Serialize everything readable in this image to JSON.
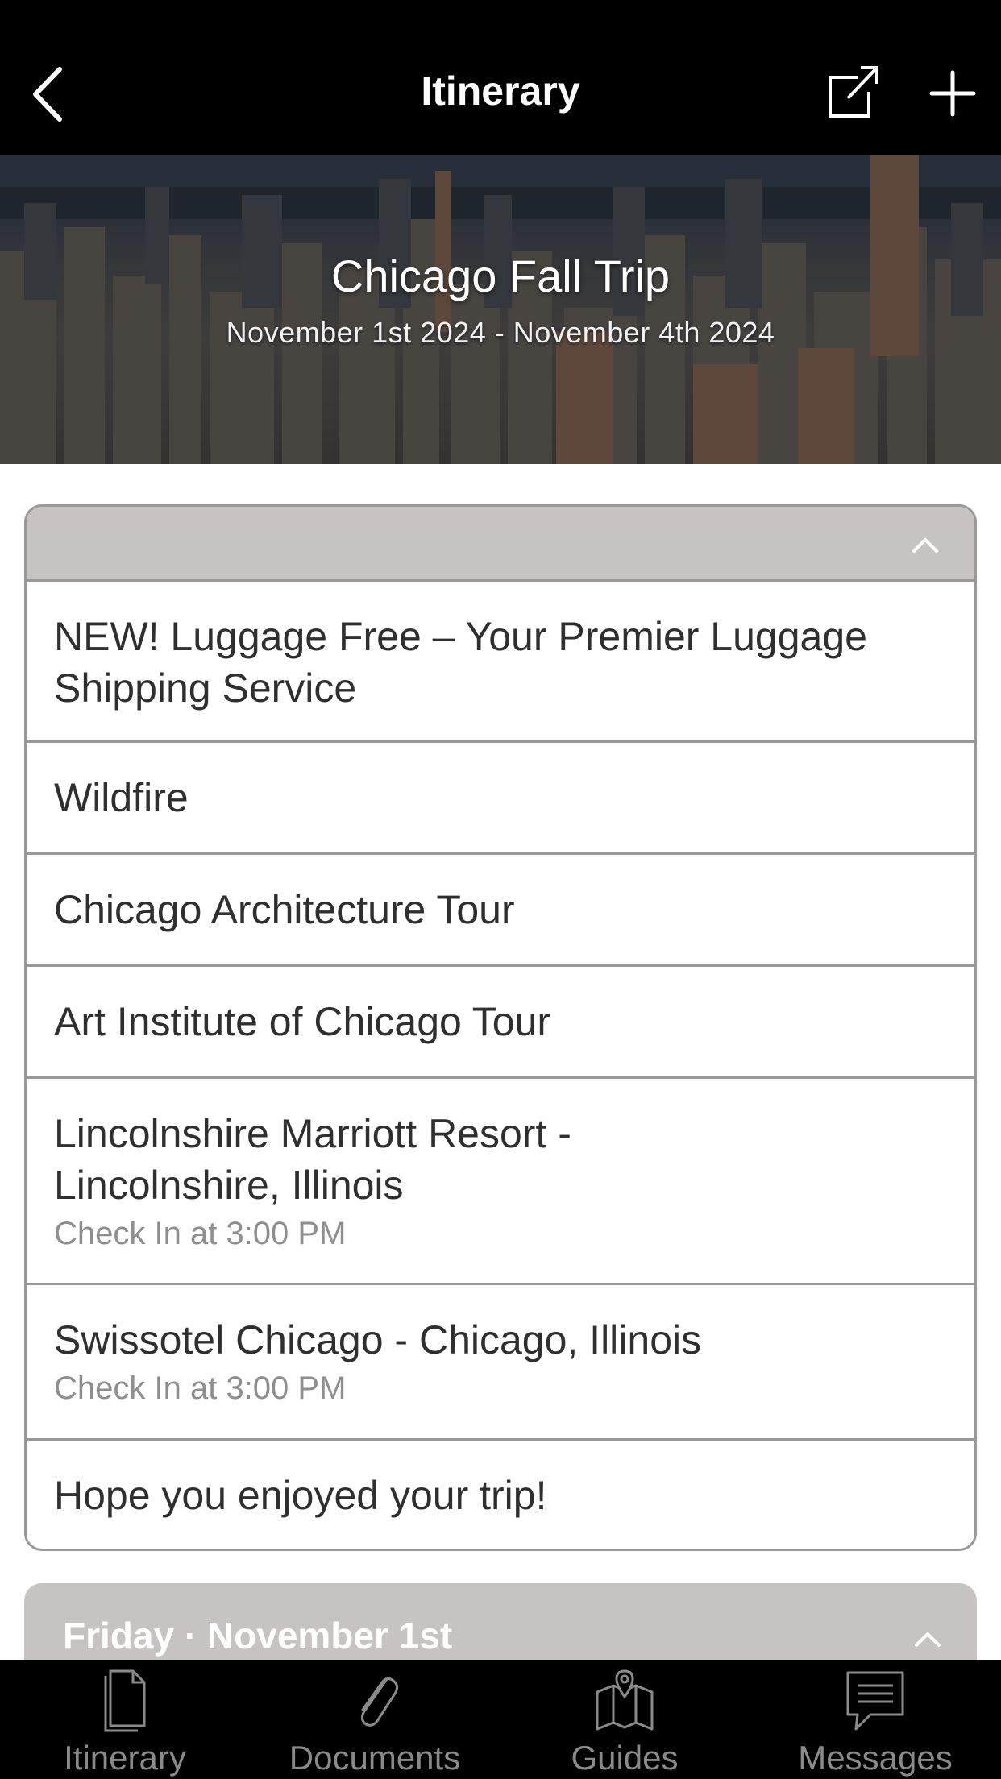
{
  "header": {
    "title": "Itinerary",
    "back_icon": "chevron-left-icon",
    "share_icon": "share-external-icon",
    "add_icon": "plus-icon"
  },
  "hero": {
    "title": "Chicago Fall Trip",
    "dates": "November 1st 2024 - November 4th 2024"
  },
  "card1": {
    "items": [
      {
        "title": "NEW! Luggage Free – Your Premier Luggage Shipping Service",
        "subtitle": ""
      },
      {
        "title": "Wildfire",
        "subtitle": ""
      },
      {
        "title": "Chicago Architecture Tour",
        "subtitle": ""
      },
      {
        "title": "Art Institute of Chicago Tour",
        "subtitle": ""
      },
      {
        "title": "Lincolnshire Marriott Resort - Lincolnshire, Illinois",
        "subtitle": "Check In at 3:00 PM"
      },
      {
        "title": "Swissotel Chicago - Chicago, Illinois",
        "subtitle": "Check In at 3:00 PM"
      },
      {
        "title": "Hope you enjoyed your trip!",
        "subtitle": ""
      }
    ]
  },
  "card2": {
    "title": "Friday · November 1st"
  },
  "tabbar": {
    "tabs": [
      {
        "label": "Itinerary",
        "icon": "document-icon"
      },
      {
        "label": "Documents",
        "icon": "paperclip-icon"
      },
      {
        "label": "Guides",
        "icon": "map-pin-icon"
      },
      {
        "label": "Messages",
        "icon": "message-icon"
      }
    ]
  },
  "colors": {
    "header_bg": "#000000",
    "section_header_bg": "#c7c3c3",
    "border": "#9b9898",
    "tab_inactive": "#8a8a8a"
  }
}
